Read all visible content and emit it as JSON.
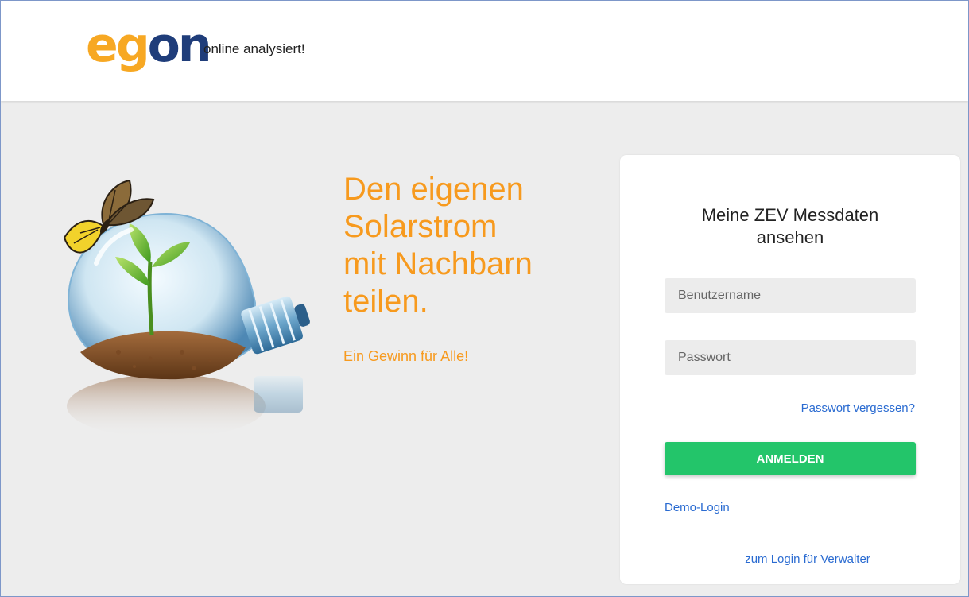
{
  "header": {
    "logo_text": "egon",
    "tagline": "online analysiert!"
  },
  "hero": {
    "headline_lines": [
      "Den eigenen",
      "Solarstrom",
      "mit Nachbarn",
      "teilen."
    ],
    "subline": "Ein Gewinn für Alle!",
    "accent_color": "#f79a1e"
  },
  "login": {
    "title_line1": "Meine ZEV Messdaten",
    "title_line2": "ansehen",
    "username_placeholder": "Benutzername",
    "username_value": "",
    "password_placeholder": "Passwort",
    "password_value": "",
    "forgot_password": "Passwort vergessen?",
    "submit_label": "ANMELDEN",
    "demo_login": "Demo-Login",
    "admin_login": "zum Login für Verwalter",
    "button_color": "#23c56a",
    "link_color": "#2a6bd1"
  },
  "icons": [
    "lightbulb-plant-illustration",
    "butterfly-icon"
  ]
}
